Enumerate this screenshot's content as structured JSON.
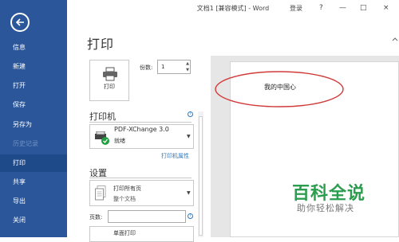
{
  "window": {
    "title": "文档1 [兼容模式] - Word",
    "login": "登录",
    "help": "?",
    "minimize": "—",
    "maximize": "□",
    "close": "×"
  },
  "nav": {
    "items": [
      {
        "label": "信息",
        "state": "normal"
      },
      {
        "label": "新建",
        "state": "normal"
      },
      {
        "label": "打开",
        "state": "normal"
      },
      {
        "label": "保存",
        "state": "normal"
      },
      {
        "label": "另存为",
        "state": "normal"
      },
      {
        "label": "历史记录",
        "state": "disabled"
      },
      {
        "label": "打印",
        "state": "active"
      },
      {
        "label": "共享",
        "state": "normal"
      },
      {
        "label": "导出",
        "state": "normal"
      },
      {
        "label": "关闭",
        "state": "normal"
      }
    ]
  },
  "print": {
    "heading": "打印",
    "button_label": "打印",
    "copies_label": "份数:",
    "copies_value": "1",
    "printer_section": "打印机",
    "printer_name": "PDF-XChange 3.0",
    "printer_status": "就绪",
    "printer_properties": "打印机属性",
    "settings_section": "设置",
    "pages_option_main": "打印所有页",
    "pages_option_sub": "整个文档",
    "pages_label": "页数:",
    "sides_option": "单面打印"
  },
  "preview": {
    "document_text": "我的中国心"
  },
  "watermark": {
    "title": "百科全说",
    "subtitle": "助你轻松解决"
  },
  "colors": {
    "nav_bg": "#2b579a",
    "nav_active": "#1f4a8a",
    "link": "#2b79c2",
    "watermark": "#2a9d4e",
    "annotation": "#d23a3a"
  }
}
